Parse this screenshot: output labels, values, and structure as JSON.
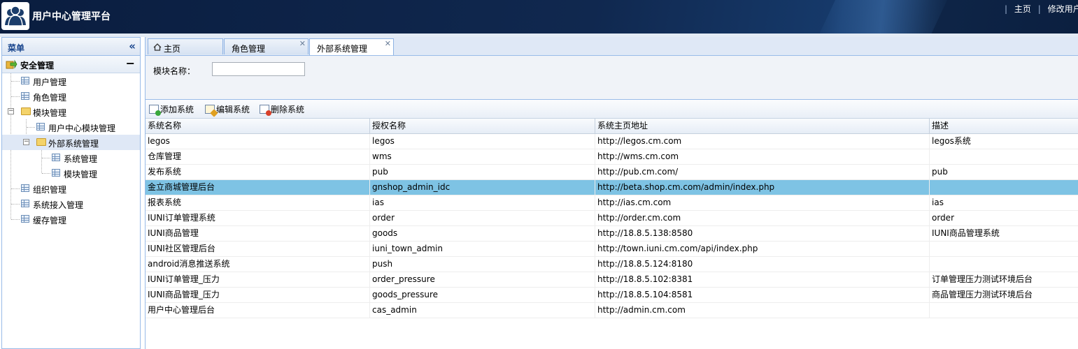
{
  "header": {
    "title": "用户中心管理平台",
    "links": [
      "主页",
      "修改用户信"
    ]
  },
  "sidebar": {
    "title": "菜单",
    "section": "安全管理",
    "items": [
      {
        "label": "用户管理",
        "level": 1,
        "type": "leaf"
      },
      {
        "label": "角色管理",
        "level": 1,
        "type": "leaf"
      },
      {
        "label": "模块管理",
        "level": 1,
        "type": "folder"
      },
      {
        "label": "用户中心模块管理",
        "level": 2,
        "type": "leaf"
      },
      {
        "label": "外部系统管理",
        "level": 2,
        "type": "folder"
      },
      {
        "label": "系统管理",
        "level": 3,
        "type": "leaf"
      },
      {
        "label": "模块管理",
        "level": 3,
        "type": "leaf"
      },
      {
        "label": "组织管理",
        "level": 1,
        "type": "leaf"
      },
      {
        "label": "系统接入管理",
        "level": 1,
        "type": "leaf"
      },
      {
        "label": "缓存管理",
        "level": 1,
        "type": "leaf"
      }
    ]
  },
  "tabs": [
    {
      "label": "主页",
      "closable": false
    },
    {
      "label": "角色管理",
      "closable": true
    },
    {
      "label": "外部系统管理",
      "closable": true,
      "active": true
    }
  ],
  "search": {
    "label": "模块名称：",
    "value": ""
  },
  "toolbar": {
    "add": "添加系统",
    "edit": "编辑系统",
    "delete": "删除系统"
  },
  "table": {
    "columns": [
      "系统名称",
      "授权名称",
      "系统主页地址",
      "描述"
    ],
    "selected_row": 3,
    "rows": [
      [
        "legos",
        "legos",
        "http://legos.cm.com",
        "legos系统"
      ],
      [
        "仓库管理",
        "wms",
        "http://wms.cm.com",
        ""
      ],
      [
        "发布系统",
        "pub",
        "http://pub.cm.com/",
        "pub"
      ],
      [
        "金立商城管理后台",
        "gnshop_admin_idc",
        "http://beta.shop.cm.com/admin/index.php",
        ""
      ],
      [
        "报表系统",
        "ias",
        "http://ias.cm.com",
        "ias"
      ],
      [
        "IUNI订单管理系统",
        "order",
        "http://order.cm.com",
        "order"
      ],
      [
        "IUNI商品管理",
        "goods",
        "http://18.8.5.138:8580",
        "IUNI商品管理系统"
      ],
      [
        "IUNI社区管理后台",
        "iuni_town_admin",
        "http://town.iuni.cm.com/api/index.php",
        ""
      ],
      [
        "android消息推送系统",
        "push",
        "http://18.8.5.124:8180",
        ""
      ],
      [
        "IUNI订单管理_压力",
        "order_pressure",
        "http://18.8.5.102:8381",
        "订单管理压力测试环境后台"
      ],
      [
        "IUNI商品管理_压力",
        "goods_pressure",
        "http://18.8.5.104:8581",
        "商品管理压力测试环境后台"
      ],
      [
        "用户中心管理后台",
        "cas_admin",
        "http://admin.cm.com",
        ""
      ]
    ]
  },
  "colors": {
    "header_bg": "#10284f",
    "selected_row": "#7ec3e4",
    "panel_border": "#99bbe8"
  }
}
